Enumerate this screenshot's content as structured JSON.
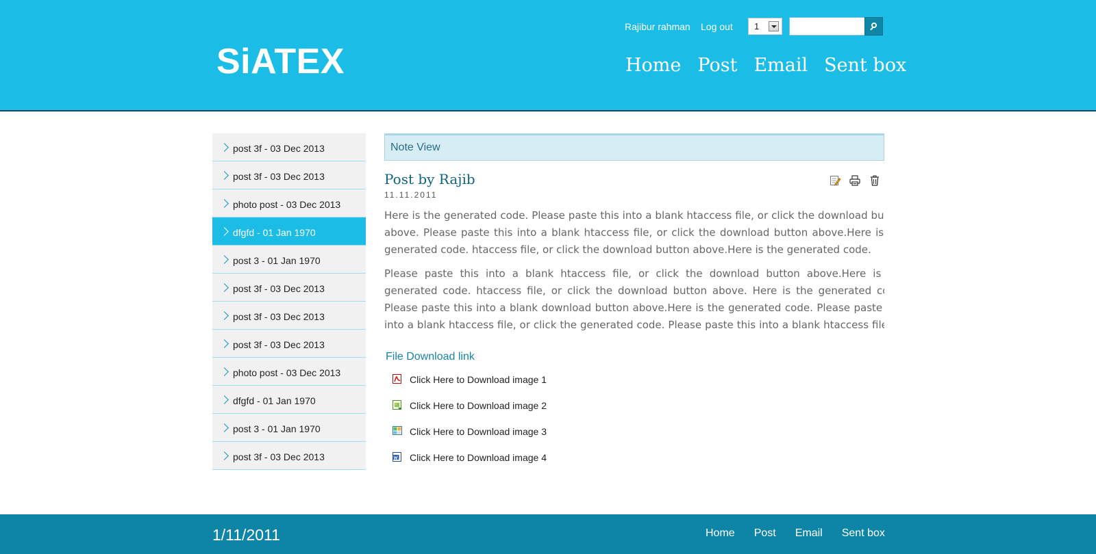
{
  "header": {
    "logo": "SiATEX",
    "user_name": "Rajibur rahman",
    "logout_label": "Log out",
    "page_select_value": "1",
    "search_value": "",
    "nav": [
      "Home",
      "Post",
      "Email",
      "Sent box"
    ]
  },
  "sidebar": {
    "items": [
      {
        "label": "post 3f - 03 Dec 2013",
        "active": false
      },
      {
        "label": "post 3f - 03 Dec 2013",
        "active": false
      },
      {
        "label": "photo post - 03 Dec 2013",
        "active": false
      },
      {
        "label": "dfgfd - 01 Jan 1970",
        "active": true
      },
      {
        "label": "post 3 - 01 Jan 1970",
        "active": false
      },
      {
        "label": "post 3f - 03 Dec 2013",
        "active": false
      },
      {
        "label": "post 3f - 03 Dec 2013",
        "active": false
      },
      {
        "label": "post 3f - 03 Dec 2013",
        "active": false
      },
      {
        "label": "photo post - 03 Dec 2013",
        "active": false
      },
      {
        "label": "dfgfd - 01 Jan 1970",
        "active": false
      },
      {
        "label": "post 3 - 01 Jan 1970",
        "active": false
      },
      {
        "label": "post 3f - 03 Dec 2013",
        "active": false
      }
    ]
  },
  "main": {
    "section_title": "Note View",
    "post_title": "Post by Rajib",
    "post_date": "11.11.2011",
    "tool_icons": [
      "edit-icon",
      "print-icon",
      "trash-icon"
    ],
    "paragraphs": [
      "Here is the generated code. Please paste this into a blank htaccess file, or click the download button above. Please paste this into a blank htaccess file, or click the download button above.Here is the generated code. htaccess file, or click the download button above.Here is the generated code.",
      "Please paste this into a blank htaccess file, or click the download button above.Here is the generated code. htaccess file, or click the download button above. Here is the generated code. Please paste this into a blank download button above.Here is the generated code. Please paste this into a blank htaccess file, or click the generated code. Please paste this into a blank htaccess file, or click the download button above."
    ],
    "download_title": "File Download link",
    "downloads": [
      {
        "label": "Click Here to Download image 1",
        "icon": "pdf-file-icon"
      },
      {
        "label": "Click Here to Download image 2",
        "icon": "image-file-icon"
      },
      {
        "label": "Click Here to Download image 3",
        "icon": "spreadsheet-file-icon"
      },
      {
        "label": "Click Here to Download image 4",
        "icon": "word-file-icon"
      }
    ]
  },
  "footer": {
    "date": "1/11/2011",
    "nav": [
      "Home",
      "Post",
      "Email",
      "Sent box"
    ]
  },
  "colors": {
    "header_bg": "#1bbde6",
    "footer_bg": "#0e84a6",
    "active_item": "#1bbde6",
    "link": "#1683a8"
  }
}
